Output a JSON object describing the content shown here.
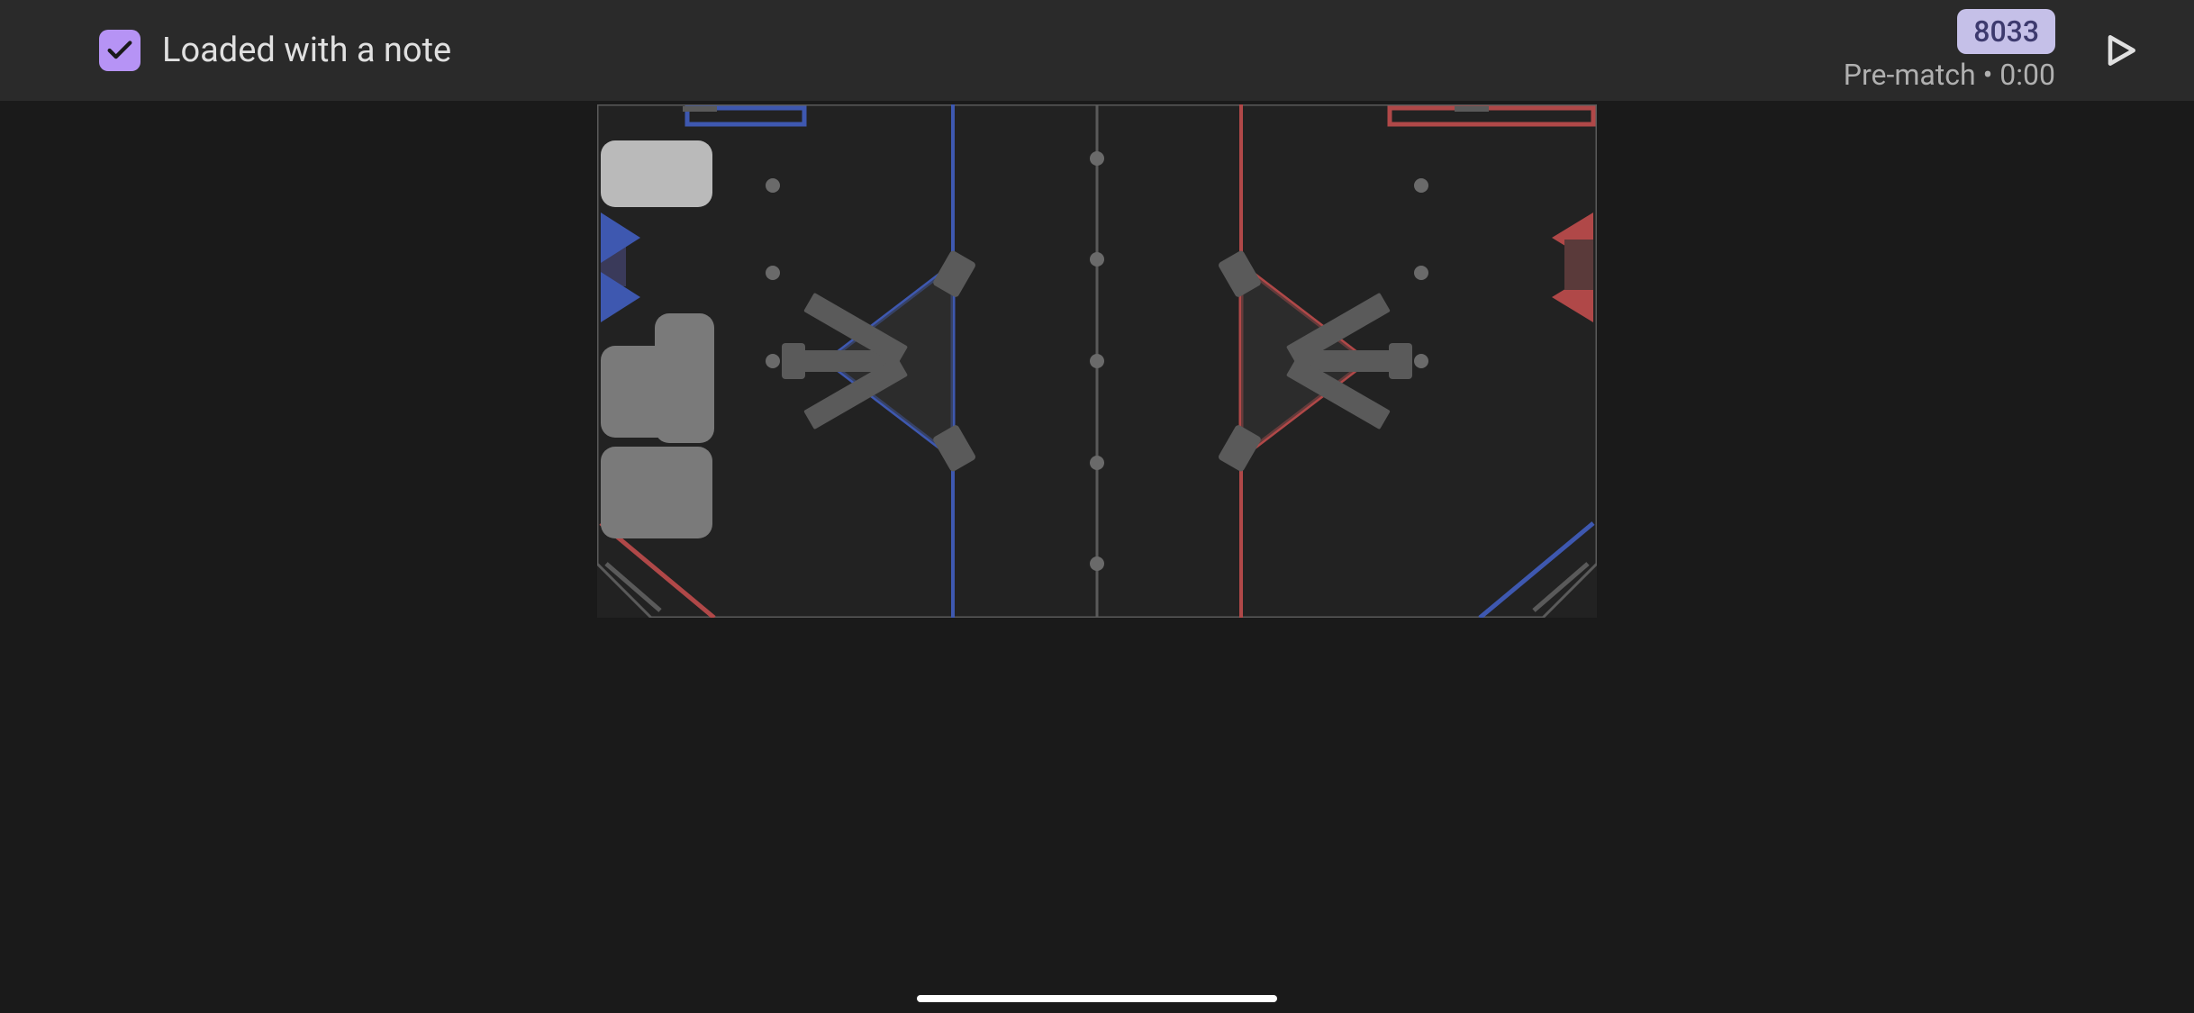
{
  "header": {
    "checkbox_checked": true,
    "status_label": "Loaded with a note",
    "team_number": "8033",
    "match_phase": "Pre-match",
    "timer": "0:00"
  },
  "colors": {
    "accent": "#b693f5",
    "blue_alliance": "#3e58b0",
    "red_alliance": "#b04848",
    "field_bg": "#222222",
    "field_line": "#5a5a5a"
  }
}
